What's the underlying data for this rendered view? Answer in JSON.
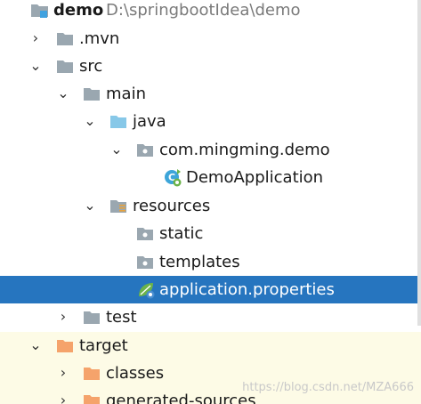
{
  "tree": {
    "rows": [
      {
        "label": "demo",
        "path": "D:\\springbootIdea\\demo",
        "icon": "module-folder-icon",
        "expanded": true
      },
      {
        "label": ".mvn",
        "icon": "folder-icon",
        "expanded": false
      },
      {
        "label": "src",
        "icon": "folder-icon",
        "expanded": true
      },
      {
        "label": "main",
        "icon": "folder-icon",
        "expanded": true
      },
      {
        "label": "java",
        "icon": "source-root-folder-icon",
        "expanded": true
      },
      {
        "label": "com.mingming.demo",
        "icon": "package-icon",
        "expanded": true
      },
      {
        "label": "DemoApplication",
        "icon": "spring-boot-class-icon"
      },
      {
        "label": "resources",
        "icon": "resources-folder-icon",
        "expanded": true
      },
      {
        "label": "static",
        "icon": "package-icon"
      },
      {
        "label": "templates",
        "icon": "package-icon"
      },
      {
        "label": "application.properties",
        "icon": "spring-properties-icon",
        "selected": true
      },
      {
        "label": "test",
        "icon": "folder-icon",
        "expanded": false
      },
      {
        "label": "target",
        "icon": "excluded-folder-icon",
        "expanded": true
      },
      {
        "label": "classes",
        "icon": "excluded-folder-icon",
        "expanded": false
      },
      {
        "label": "generated-sources",
        "icon": "excluded-folder-icon",
        "expanded": false
      }
    ]
  },
  "watermark": "https://blog.csdn.net/MZA666",
  "colors": {
    "selection": "#2675bf",
    "excluded_background": "#fdfbe6",
    "folder_gray": "#9aa7b0",
    "source_blue": "#87c8e8",
    "excluded_orange": "#f5a36b"
  }
}
